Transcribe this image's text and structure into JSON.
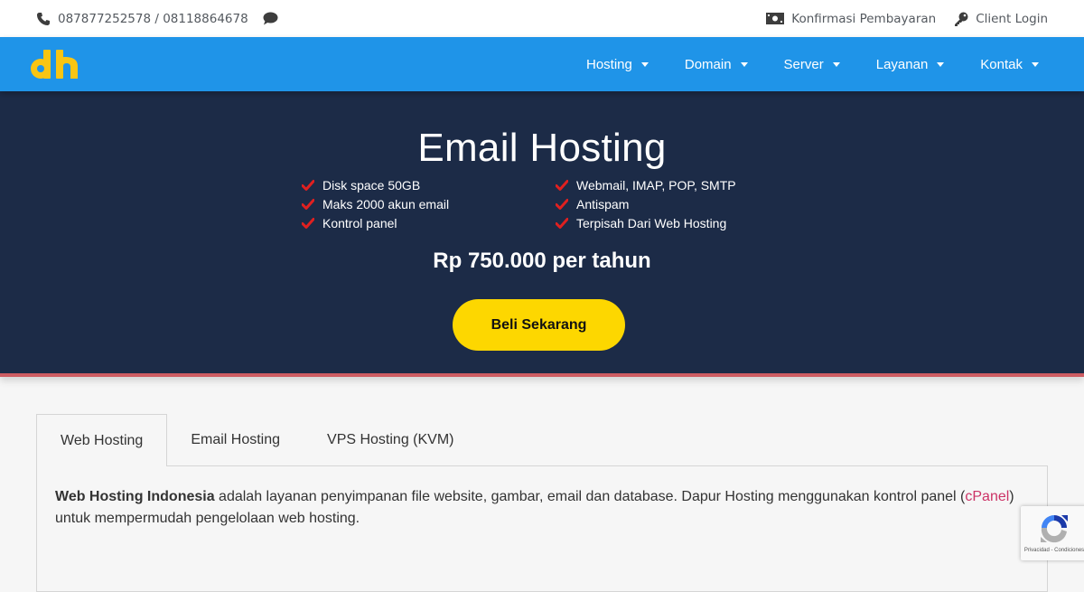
{
  "topbar": {
    "phone_icon": "phone-icon",
    "phone_text": "087877252578 / 08118864678",
    "chat_icon": "chat-bubble-icon",
    "payment_icon": "money-bill-icon",
    "payment_label": "Konfirmasi Pembayaran",
    "login_icon": "key-icon",
    "login_label": "Client Login"
  },
  "navbar": {
    "logo_text": "dh",
    "items": [
      {
        "label": "Hosting"
      },
      {
        "label": "Domain"
      },
      {
        "label": "Server"
      },
      {
        "label": "Layanan"
      },
      {
        "label": "Kontak"
      }
    ]
  },
  "hero": {
    "title": "Email Hosting",
    "features_left": [
      "Disk space 50GB",
      "Maks 2000 akun email",
      "Kontrol panel"
    ],
    "features_right": [
      "Webmail, IMAP, POP, SMTP",
      "Antispam",
      "Terpisah Dari Web Hosting"
    ],
    "price": "Rp 750.000 per tahun",
    "buy_label": "Beli Sekarang"
  },
  "tabs": {
    "items": [
      {
        "label": "Web Hosting",
        "active": true
      },
      {
        "label": "Email Hosting",
        "active": false
      },
      {
        "label": "VPS Hosting (KVM)",
        "active": false
      }
    ],
    "panel": {
      "bold_text": "Web Hosting Indonesia",
      "text_before_link": " adalah layanan penyimpanan file website, gambar, email dan database. Dapur Hosting menggunakan kontrol panel (",
      "link_text": "cPanel",
      "text_after_link": ") untuk mempermudah pengelolaan web hosting."
    }
  },
  "recaptcha": {
    "legal_text": "Privacidad - Condiciones"
  },
  "colors": {
    "nav_blue": "#1f94e8",
    "hero_navy": "#1c2b47",
    "accent_yellow": "#fdd700",
    "accent_red": "#cd5c62",
    "check_red": "#e02020",
    "link_pink": "#cc3366"
  }
}
